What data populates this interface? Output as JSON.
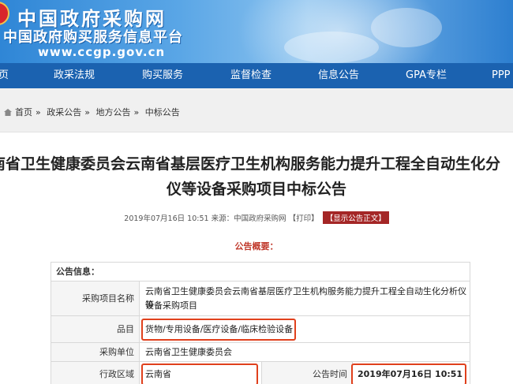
{
  "header": {
    "site_title": "中国政府采购网",
    "site_subtitle": "中国政府购买服务信息平台",
    "site_url": "www.ccgp.gov.cn"
  },
  "nav": {
    "items": [
      "页",
      "政采法规",
      "购买服务",
      "监督检查",
      "信息公告",
      "GPA专栏",
      "PPP"
    ]
  },
  "breadcrumb": {
    "home": "首页",
    "items": [
      "政采公告",
      "地方公告",
      "中标公告"
    ],
    "separator": "»"
  },
  "article": {
    "title_line1": "南省卫生健康委员会云南省基层医疗卫生机构服务能力提升工程全自动生化分",
    "title_line2": "仪等设备采购项目中标公告",
    "datetime": "2019年07月16日 10:51",
    "source_label": "来源：",
    "source": "中国政府采购网",
    "print_link": "【打印】",
    "show_body_button": "【显示公告正文】",
    "summary_label": "公告概要："
  },
  "info_table": {
    "header": "公告信息：",
    "project_name_label": "采购项目名称",
    "project_name_value_line1": "云南省卫生健康委员会云南省基层医疗卫生机构服务能力提升工程全自动生化分析仪等",
    "project_name_value_line2": "设备采购项目",
    "category_label": "品目",
    "category_value": "货物/专用设备/医疗设备/临床检验设备",
    "purchaser_label": "采购单位",
    "purchaser_value": "云南省卫生健康委员会",
    "region_label": "行政区域",
    "region_value": "云南省",
    "announce_time_label": "公告时间",
    "announce_time_value": "2019年07月16日  10:51"
  },
  "colors": {
    "nav_bg": "#1b62b0",
    "highlight": "#e0401c",
    "show_button_bg": "#a42626",
    "summary_red": "#c0392b"
  }
}
